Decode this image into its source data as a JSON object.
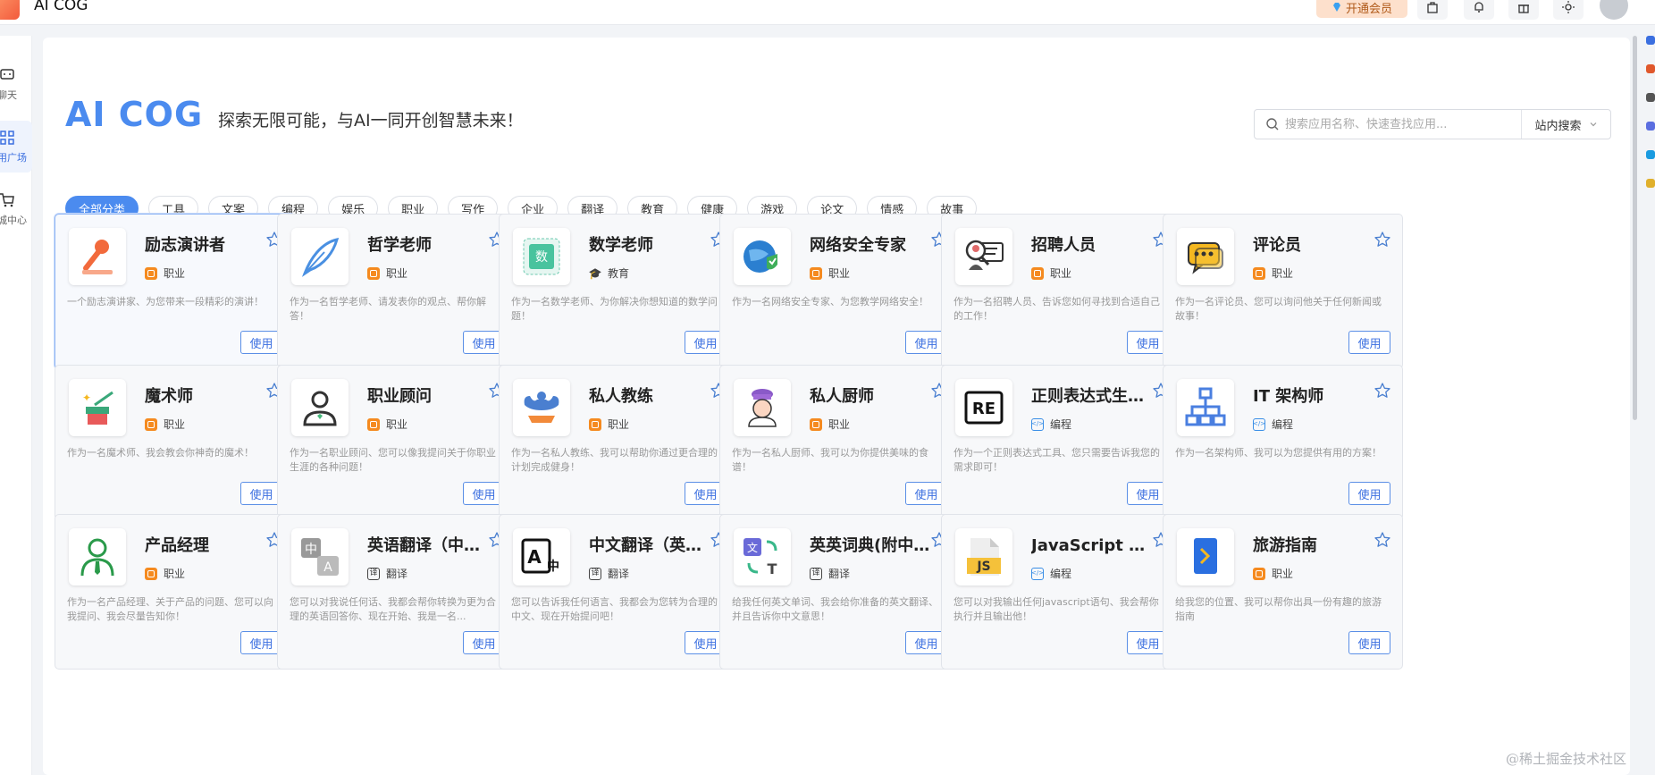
{
  "app": {
    "title": "AI COG"
  },
  "header": {
    "vip_label": "开通会员"
  },
  "sidebar": {
    "items": [
      {
        "label": "聊天",
        "icon": "chat-icon"
      },
      {
        "label": "应用广场",
        "icon": "grid-icon"
      },
      {
        "label": "商城中心",
        "icon": "cart-icon"
      }
    ]
  },
  "hero": {
    "title": "AI COG",
    "subtitle": "探索无限可能，与AI一同开创智慧未来！"
  },
  "search": {
    "placeholder": "搜索应用名称、快速查找应用...",
    "scope_label": "站内搜索"
  },
  "categories": [
    "全部分类",
    "工具",
    "文案",
    "编程",
    "娱乐",
    "职业",
    "写作",
    "企业",
    "翻译",
    "教育",
    "健康",
    "游戏",
    "论文",
    "情感",
    "故事"
  ],
  "use_label": "使用",
  "cards": [
    {
      "title": "励志演讲者",
      "tag": "职业",
      "tag_type": "job",
      "icon": "microphone-icon",
      "desc": "一个励志演讲家、为您带来一段精彩的演讲！"
    },
    {
      "title": "哲学老师",
      "tag": "职业",
      "tag_type": "job",
      "icon": "quill-icon",
      "desc": "作为一名哲学老师、请发表你的观点、帮你解答！"
    },
    {
      "title": "数学老师",
      "tag": "教育",
      "tag_type": "edu",
      "icon": "math-book-icon",
      "desc": "作为一名数学老师、为你解决你想知道的数学问题！"
    },
    {
      "title": "网络安全专家",
      "tag": "职业",
      "tag_type": "job",
      "icon": "globe-shield-icon",
      "desc": "作为一名网络安全专家、为您教学网络安全！"
    },
    {
      "title": "招聘人员",
      "tag": "职业",
      "tag_type": "job",
      "icon": "recruiter-icon",
      "desc": "作为一名招聘人员、告诉您如何寻找到合适自己的工作！"
    },
    {
      "title": "评论员",
      "tag": "职业",
      "tag_type": "job",
      "icon": "speech-bubble-icon",
      "desc": "作为一名评论员、您可以询问他关于任何新闻或故事！"
    },
    {
      "title": "魔术师",
      "tag": "职业",
      "tag_type": "job",
      "icon": "magic-hat-icon",
      "desc": "作为一名魔术师、我会教会你神奇的魔术！"
    },
    {
      "title": "职业顾问",
      "tag": "职业",
      "tag_type": "job",
      "icon": "advisor-icon",
      "desc": "作为一名职业顾问、您可以像我提问关于你职业生涯的各种问题！"
    },
    {
      "title": "私人教练",
      "tag": "职业",
      "tag_type": "job",
      "icon": "muscle-icon",
      "desc": "作为一名私人教练、我可以帮助你通过更合理的计划完成健身！"
    },
    {
      "title": "私人厨师",
      "tag": "职业",
      "tag_type": "job",
      "icon": "chef-icon",
      "desc": "作为一名私人厨师、我可以为你提供美味的食谱！"
    },
    {
      "title": "正则表达式生成器",
      "tag": "编程",
      "tag_type": "code",
      "icon": "regex-icon",
      "desc": "作为一个正则表达式工具、您只需要告诉我您的需求即可！"
    },
    {
      "title": "IT 架构师",
      "tag": "编程",
      "tag_type": "code",
      "icon": "architecture-icon",
      "desc": "作为一名架构师、我可以为您提供有用的方案！"
    },
    {
      "title": "产品经理",
      "tag": "职业",
      "tag_type": "job",
      "icon": "manager-icon",
      "desc": "作为一名产品经理、关于产品的问题、您可以向我提问、我会尽量告知你！"
    },
    {
      "title": "英语翻译（中译英）",
      "tag": "翻译",
      "tag_type": "trans",
      "icon": "translate-zh-en-icon",
      "desc": "您可以对我说任何话、我都会帮你转换为更为合理的英语回答你、现在开始、我是一名..."
    },
    {
      "title": "中文翻译（英译中）",
      "tag": "翻译",
      "tag_type": "trans",
      "icon": "translate-en-zh-icon",
      "desc": "您可以告诉我任何语言、我都会为您转为合理的中文、现在开始提问吧！"
    },
    {
      "title": "英英词典(附中文释义)",
      "tag": "翻译",
      "tag_type": "trans",
      "icon": "dictionary-icon",
      "desc": "给我任何英文单词、我会给你准备的英文翻译、并且告诉你中文意思！"
    },
    {
      "title": "JavaScript 控制台",
      "tag": "编程",
      "tag_type": "code",
      "icon": "js-file-icon",
      "desc": "您可以对我输出任何javascript语句、我会帮你执行并且输出他！"
    },
    {
      "title": "旅游指南",
      "tag": "职业",
      "tag_type": "job",
      "icon": "travel-guide-icon",
      "desc": "给我您的位置、我可以帮你出具一份有趣的旅游指南"
    }
  ],
  "watermark": "@稀土掘金技术社区",
  "colors": {
    "accent": "#4b8bef",
    "tag_job": "#f58a1f",
    "tag_code": "#3a8ee6"
  }
}
